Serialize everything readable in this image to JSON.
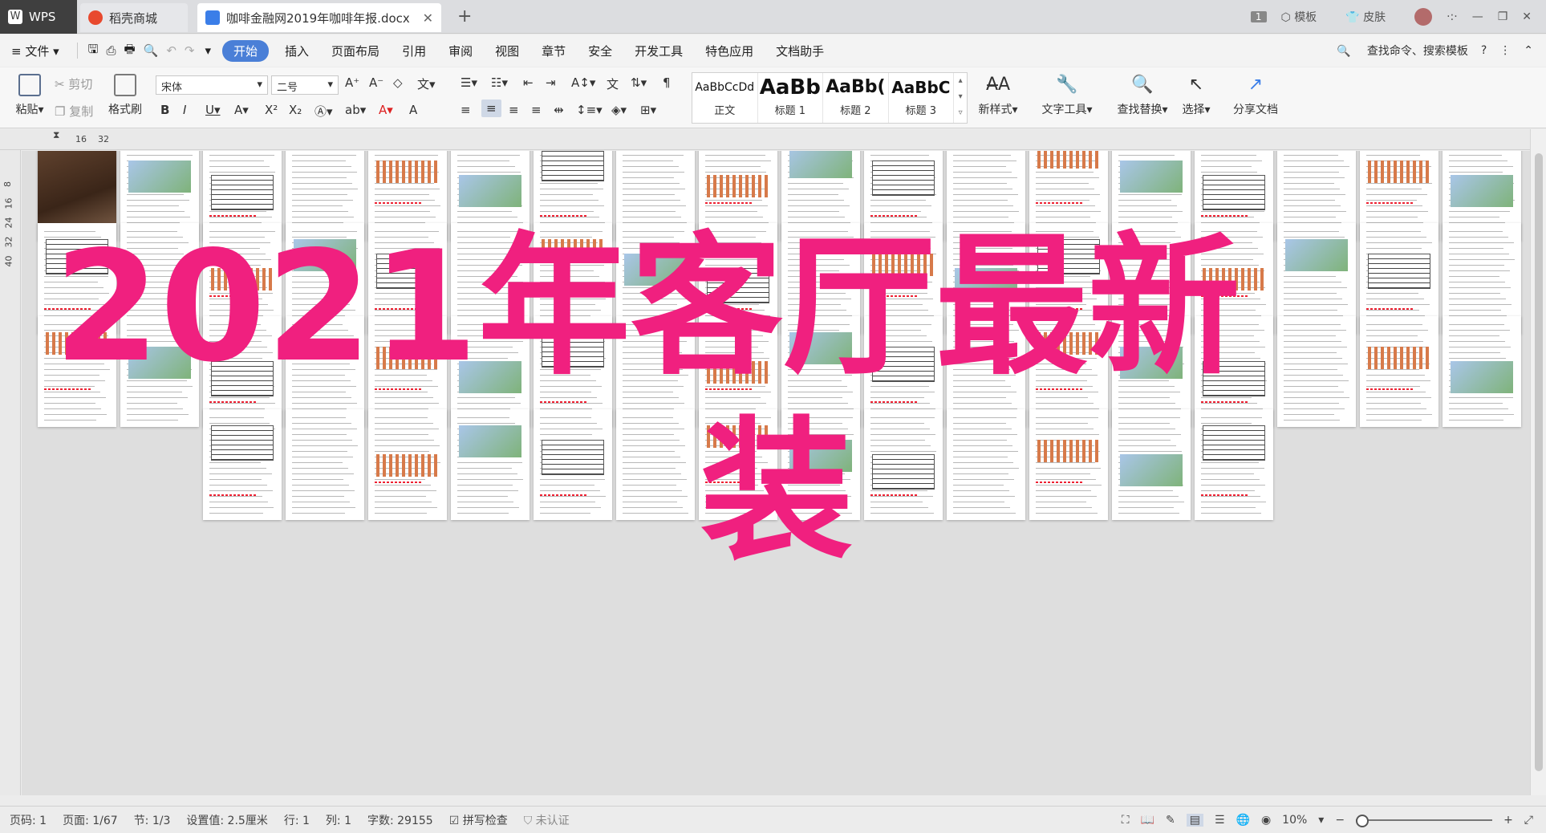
{
  "titlebar": {
    "wps_label": "WPS",
    "daoke_label": "稻壳商城",
    "doc_tab_label": "咖啡金融网2019年咖啡年报.docx",
    "page_badge": "1",
    "template_label": "模板",
    "skin_label": "皮肤"
  },
  "menu": {
    "file": "文件",
    "items": [
      "开始",
      "插入",
      "页面布局",
      "引用",
      "审阅",
      "视图",
      "章节",
      "安全",
      "开发工具",
      "特色应用",
      "文档助手"
    ],
    "search": "查找命令、搜索模板"
  },
  "ribbon": {
    "paste": "粘贴",
    "cut": "剪切",
    "copy": "复制",
    "format_painter": "格式刷",
    "font_name": "宋体",
    "font_size": "二号",
    "styles": [
      {
        "preview": "AaBbCcDd",
        "label": "正文"
      },
      {
        "preview": "AaBb",
        "label": "标题 1"
      },
      {
        "preview": "AaBb(",
        "label": "标题 2"
      },
      {
        "preview": "AaBbC",
        "label": "标题 3"
      }
    ],
    "new_style": "新样式",
    "text_tools": "文字工具",
    "find_replace": "查找替换",
    "select": "选择",
    "share": "分享文档"
  },
  "ruler": {
    "h_marks": [
      "16",
      "32"
    ],
    "v_marks": [
      "8",
      "16",
      "24",
      "32",
      "40"
    ]
  },
  "overlay": {
    "line1": "2021年客厅最新",
    "line2": "装"
  },
  "status": {
    "page_code": "页码: 1",
    "page": "页面: 1/67",
    "section": "节: 1/3",
    "setting": "设置值: 2.5厘米",
    "row": "行: 1",
    "col": "列: 1",
    "words": "字数: 29155",
    "spell": "拼写检查",
    "cert": "未认证",
    "zoom": "10%"
  },
  "colors": {
    "accent": "#4a7fd7",
    "overlay_text": "#f0207f",
    "wps_tab": "#3f3f3f"
  }
}
